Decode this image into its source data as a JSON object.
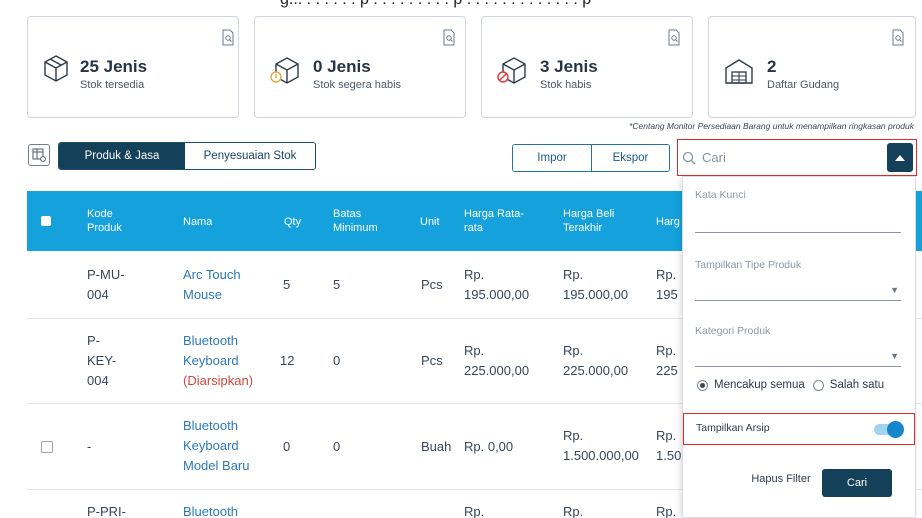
{
  "caption": "g... . . . . . . p . . . . . . . . . p . . . . . . . . . . . . . p",
  "summary_cards": [
    {
      "count": "25 Jenis",
      "label": "Stok tersedia",
      "icon": "box-icon"
    },
    {
      "count": "0 Jenis",
      "label": "Stok segera habis",
      "icon": "box-warning-icon"
    },
    {
      "count": "3 Jenis",
      "label": "Stok habis",
      "icon": "box-empty-icon"
    },
    {
      "count": "2",
      "label": "Daftar Gudang",
      "icon": "warehouse-icon"
    }
  ],
  "monitor_note": "*Centang Monitor Persediaan Barang untuk menampilkan ringkasan produk",
  "tabs": {
    "products": "Produk & Jasa",
    "adjustment": "Penyesuaian Stok"
  },
  "actions": {
    "import": "Impor",
    "export": "Ekspor"
  },
  "search": {
    "placeholder": "Cari"
  },
  "table": {
    "headers": {
      "code": "Kode Produk",
      "name": "Nama",
      "qty": "Qty",
      "min": "Batas Minimum",
      "unit": "Unit",
      "avg": "Harga Rata-rata",
      "last": "Harga Beli Terakhir",
      "sell": "Harg"
    },
    "rows": [
      {
        "code": "P-MU-004",
        "name": "Arc Touch Mouse",
        "archived": "",
        "qty": "5",
        "min": "5",
        "unit": "Pcs",
        "avg": "Rp. 195.000,00",
        "last": "Rp. 195.000,00",
        "sell": "Rp. 195"
      },
      {
        "code": "P-KEY-004",
        "name": "Bluetooth Keyboard",
        "archived": "(Diarsipkan)",
        "qty": "12",
        "min": "0",
        "unit": "Pcs",
        "avg": "Rp. 225.000,00",
        "last": "Rp. 225.000,00",
        "sell": "Rp. 225"
      },
      {
        "code": "-",
        "name": "Bluetooth Keyboard Model Baru",
        "archived": "",
        "qty": "0",
        "min": "0",
        "unit": "Buah",
        "avg": "Rp. 0,00",
        "last": "Rp. 1.500.000,00",
        "sell": "Rp. 1.50"
      },
      {
        "code": "P-PRI-",
        "name": "Bluetooth",
        "archived": "",
        "qty": "",
        "min": "",
        "unit": "",
        "avg": "Rp.",
        "last": "Rp.",
        "sell": "Rp."
      }
    ]
  },
  "filter_panel": {
    "keyword_label": "Kata Kunci",
    "type_label": "Tampilkan Tipe Produk",
    "category_label": "Kategori Produk",
    "match_all": "Mencakup semua",
    "match_any": "Salah satu",
    "show_archive": "Tampilkan Arsip",
    "show_archive_enabled": true,
    "clear": "Hapus Filter",
    "submit": "Cari"
  },
  "colors": {
    "header": "#15a2dc",
    "dark": "#14405a",
    "link": "#2a7ab8",
    "archived": "#d4473a",
    "highlight": "#e02b2b"
  }
}
